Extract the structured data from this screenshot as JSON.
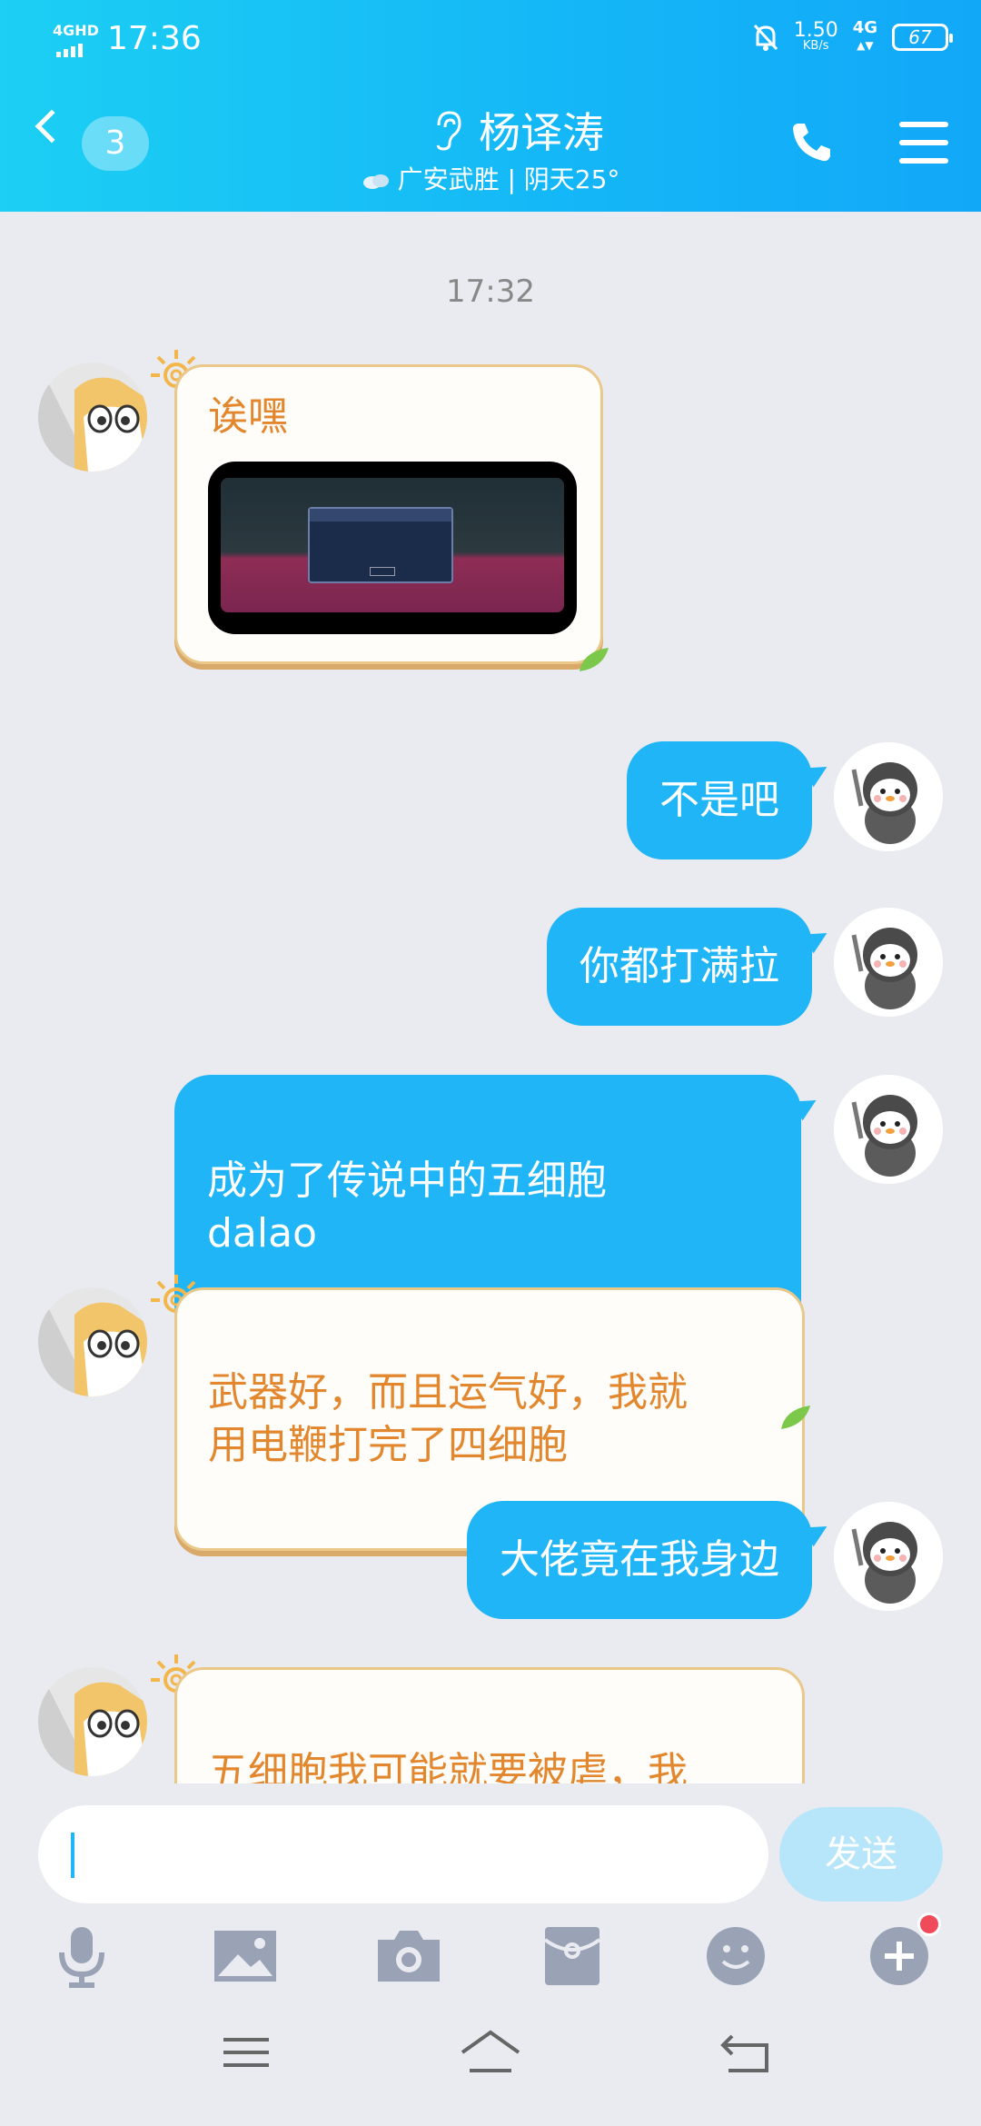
{
  "status_bar": {
    "network_label": "4GHD",
    "time": "17:36",
    "speed_value": "1.50",
    "speed_unit": "KB/s",
    "network_type": "4G",
    "battery": "67"
  },
  "header": {
    "unread_count": "3",
    "contact_name": "杨译涛",
    "subtitle": "广安武胜 | 阴天25°"
  },
  "chat": {
    "timestamp": "17:32",
    "messages": [
      {
        "side": "in",
        "text": "诶嘿"
      },
      {
        "side": "out",
        "text": "不是吧"
      },
      {
        "side": "out",
        "text": "你都打满拉"
      },
      {
        "side": "out",
        "text": "成为了传说中的五细胞\ndalao"
      },
      {
        "side": "in",
        "text": "武器好，而且运气好，我就\n用电鞭打完了四细胞"
      },
      {
        "side": "out",
        "text": "大佬竟在我身边"
      },
      {
        "side": "in",
        "text": "五细胞我可能就要被虐，我\n感觉"
      }
    ]
  },
  "input": {
    "send_label": "发送",
    "value": ""
  },
  "colors": {
    "accent": "#1fb5f6",
    "incoming_text": "#e2872d",
    "header_bg": "#14b6f7"
  },
  "toolbar_icons": [
    "microphone-icon",
    "image-icon",
    "camera-icon",
    "red-packet-icon",
    "emoji-icon",
    "plus-icon"
  ],
  "nav_icons": [
    "menu-icon",
    "home-icon",
    "back-icon"
  ]
}
